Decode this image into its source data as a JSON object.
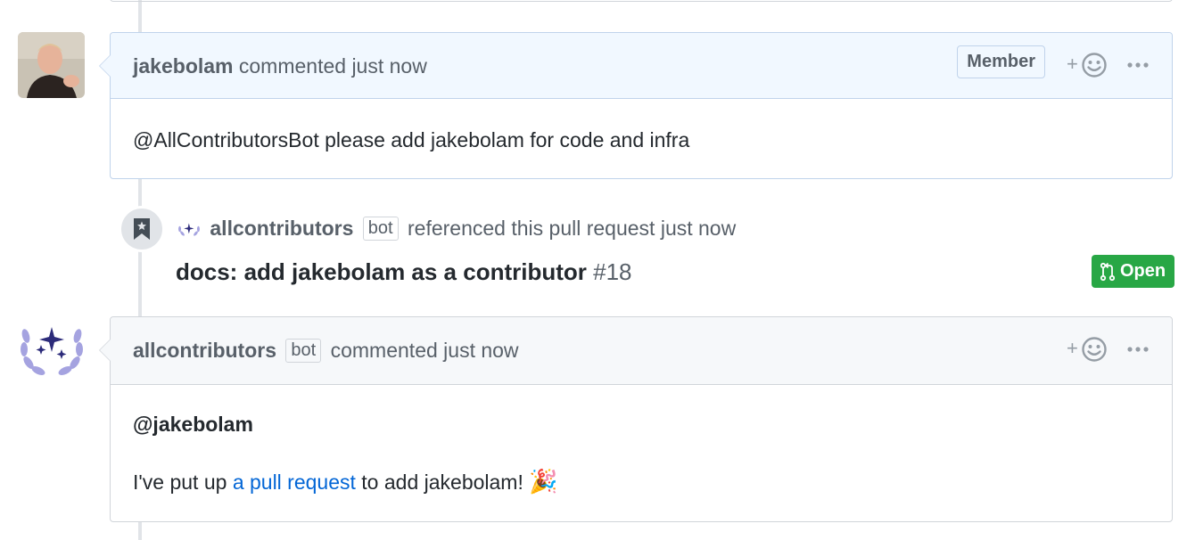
{
  "comment1": {
    "author": "jakebolam",
    "action": "commented just now",
    "badge": "Member",
    "body": "@AllContributorsBot please add jakebolam for code and infra"
  },
  "reference_event": {
    "author": "allcontributors",
    "bot_label": "bot",
    "action": "referenced this pull request just now",
    "title": "docs: add jakebolam as a contributor",
    "number": "#18",
    "state": "Open"
  },
  "comment2": {
    "author": "allcontributors",
    "bot_label": "bot",
    "action": "commented just now",
    "mention": "@jakebolam",
    "body_prefix": "I've put up ",
    "body_link": "a pull request",
    "body_suffix": " to add jakebolam!",
    "emoji": "🎉"
  },
  "reactions": {
    "plus": "+"
  },
  "colors": {
    "accent_link": "#0366d6",
    "open_green": "#28a745",
    "own_header_bg": "#f1f8ff",
    "bot_avatar": "#a5a3e0"
  },
  "icons": [
    "smiley-icon",
    "kebab-horizontal-icon",
    "bookmark-icon",
    "git-pull-request-icon",
    "laurel-sparkles-icon"
  ]
}
